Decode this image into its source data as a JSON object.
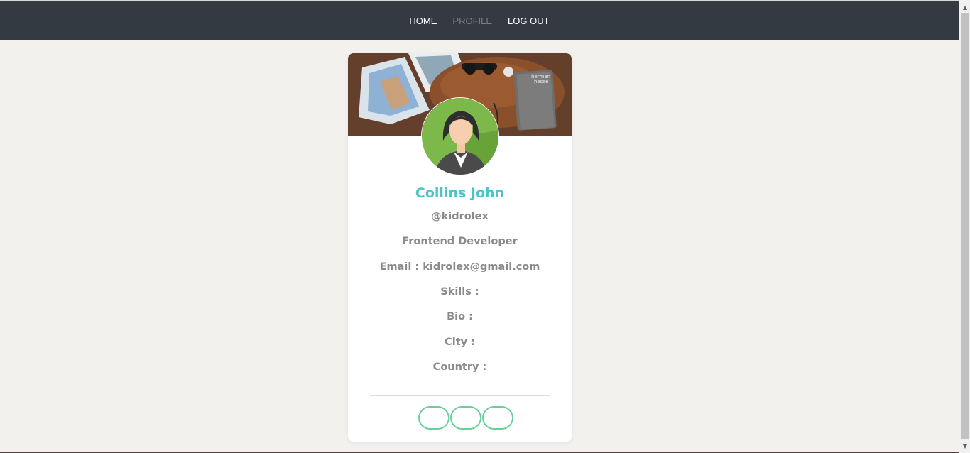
{
  "nav": {
    "items": [
      {
        "label": "HOME",
        "active": false
      },
      {
        "label": "PROFILE",
        "active": true
      },
      {
        "label": "LOG OUT",
        "active": false
      }
    ]
  },
  "profile": {
    "name": "Collins John",
    "username": "@kidrolex",
    "role": "Frontend Developer",
    "email_label": "Email : kidrolex@gmail.com",
    "skills_label": "Skills :",
    "bio_label": "Bio :",
    "city_label": "City :",
    "country_label": "Country :"
  },
  "social_buttons": [
    {
      "icon": "social-icon-1"
    },
    {
      "icon": "social-icon-2"
    },
    {
      "icon": "social-icon-3"
    }
  ],
  "colors": {
    "navbar": "#343a42",
    "accent_name": "#4fc3c7",
    "button_border": "#69cf9c",
    "background": "#f3f1ee"
  }
}
